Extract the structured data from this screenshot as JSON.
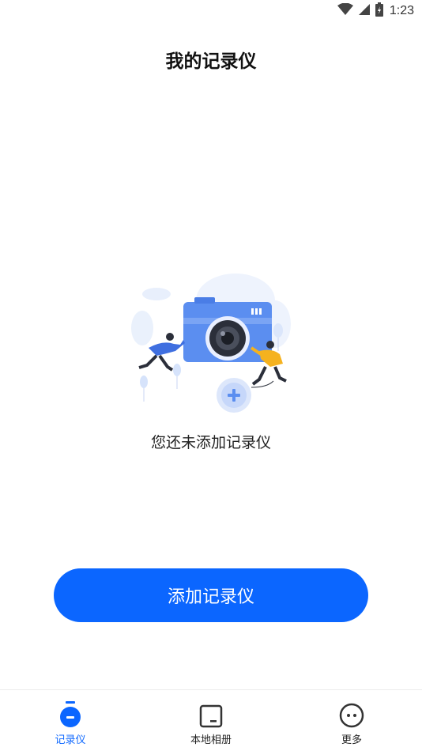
{
  "status_bar": {
    "time": "1:23",
    "icons": [
      "wifi-icon",
      "cellular-signal-icon",
      "battery-icon"
    ]
  },
  "header": {
    "title": "我的记录仪"
  },
  "main": {
    "illustration_icon": "camera-with-people-and-plus-illustration",
    "empty_message": "您还未添加记录仪",
    "add_button_label": "添加记录仪"
  },
  "tab_bar": {
    "tabs": [
      {
        "label": "记录仪",
        "icon": "recorder-icon",
        "active": true
      },
      {
        "label": "本地相册",
        "icon": "album-icon",
        "active": false
      },
      {
        "label": "更多",
        "icon": "more-icon",
        "active": false
      }
    ]
  },
  "colors": {
    "accent": "#0b66ff",
    "text_primary": "#111111",
    "illustration_blue": "#5b8ef0",
    "illustration_light": "#e6eefc",
    "figure_yellow": "#f5b21f"
  }
}
